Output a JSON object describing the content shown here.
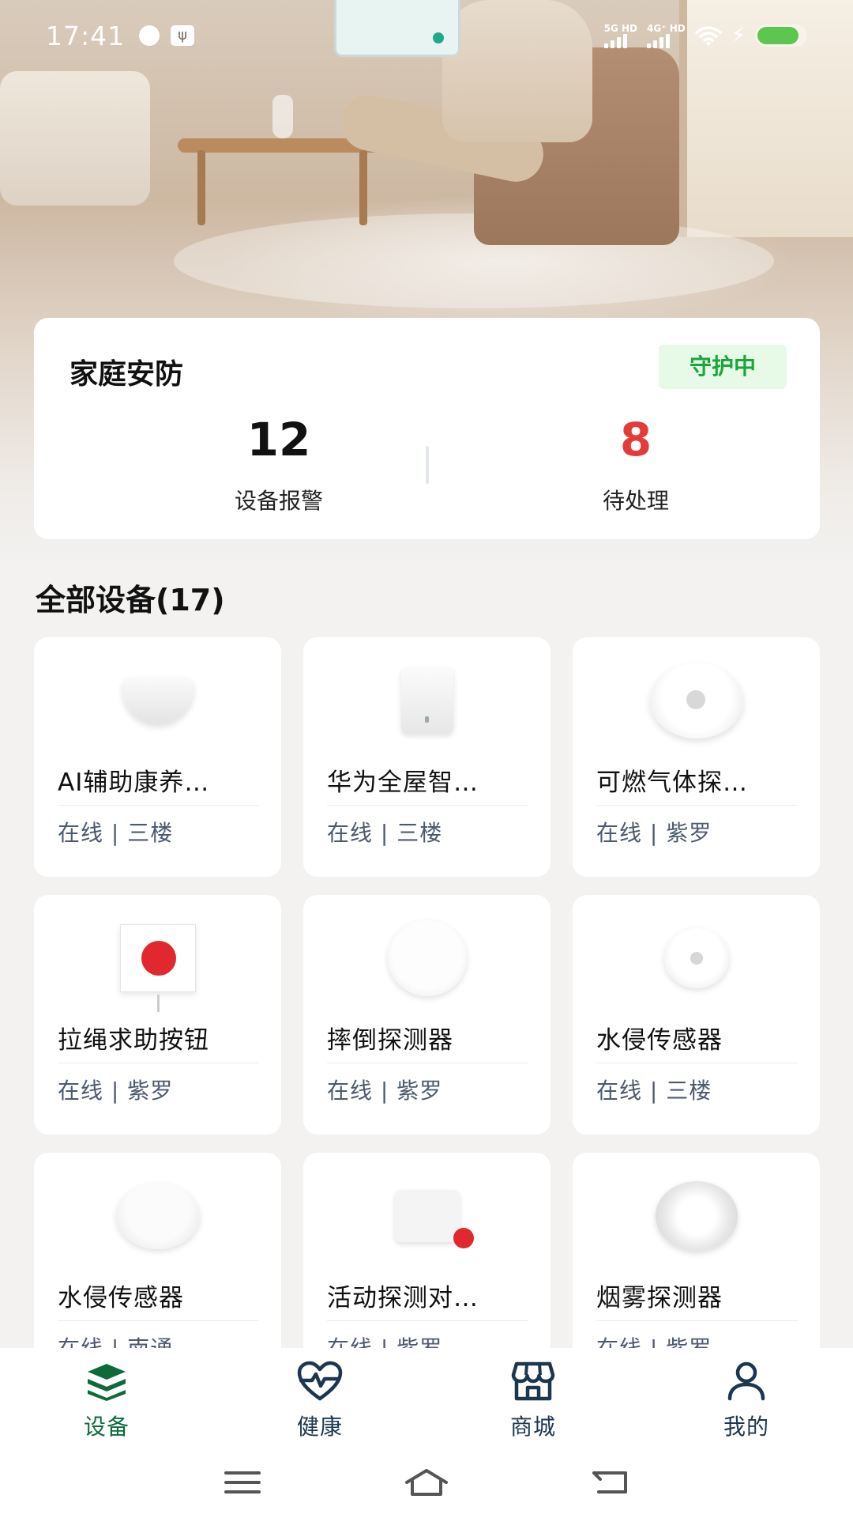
{
  "status_bar": {
    "time": "17:41",
    "network_1": "5G HD",
    "network_2": "4G⁺ HD",
    "battery_color": "#5dc651"
  },
  "summary": {
    "title": "家庭安防",
    "status_badge": "守护中",
    "alarm_count": "12",
    "alarm_label": "设备报警",
    "pending_count": "8",
    "pending_label": "待处理",
    "pending_color": "#e53a3a",
    "badge_color": "#19a63a"
  },
  "devices_section": {
    "title": "全部设备(17)",
    "items": [
      {
        "name": "AI辅助康养…",
        "meta": "在线 | 三楼",
        "icon": "ap-device-icon"
      },
      {
        "name": "华为全屋智…",
        "meta": "在线 | 三楼",
        "icon": "hub-device-icon"
      },
      {
        "name": "可燃气体探…",
        "meta": "在线 | 紫罗",
        "icon": "gas-detector-icon"
      },
      {
        "name": "拉绳求助按钮",
        "meta": "在线 | 紫罗",
        "icon": "sos-button-icon"
      },
      {
        "name": "摔倒探测器",
        "meta": "在线 | 紫罗",
        "icon": "fall-detector-icon"
      },
      {
        "name": "水侵传感器",
        "meta": "在线 | 三楼",
        "icon": "water-sensor-icon"
      },
      {
        "name": "水侵传感器",
        "meta": "在线 | 南通",
        "icon": "water-sensor-icon"
      },
      {
        "name": "活动探测对…",
        "meta": "在线 | 紫罗",
        "icon": "activity-detector-icon"
      },
      {
        "name": "烟雾探测器",
        "meta": "在线 | 紫罗",
        "icon": "smoke-detector-icon"
      }
    ]
  },
  "bottom_nav": {
    "items": [
      {
        "label": "设备",
        "icon": "devices-icon",
        "active": true
      },
      {
        "label": "健康",
        "icon": "health-icon",
        "active": false
      },
      {
        "label": "商城",
        "icon": "store-icon",
        "active": false
      },
      {
        "label": "我的",
        "icon": "profile-icon",
        "active": false
      }
    ],
    "active_color": "#0d6b3a"
  },
  "system_nav": {
    "buttons": [
      "menu-icon",
      "home-icon",
      "back-icon"
    ]
  }
}
